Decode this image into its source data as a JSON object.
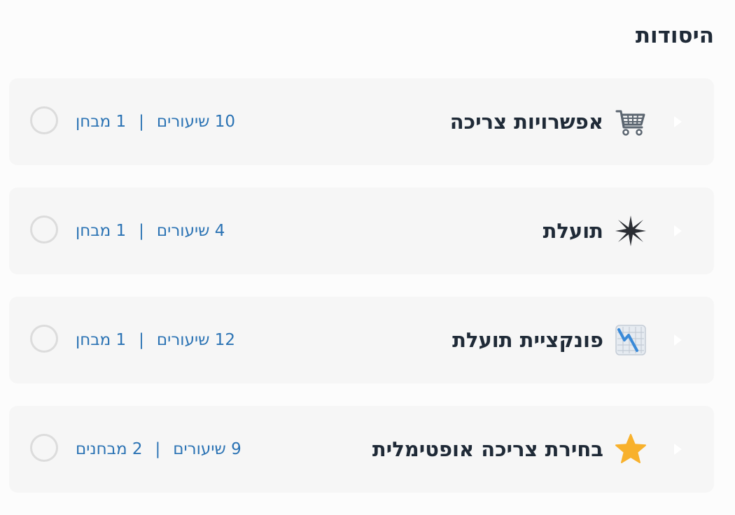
{
  "section": {
    "title": "היסודות"
  },
  "units": [
    {
      "title": "אפשרויות צריכה",
      "icon": "shopping-cart-icon",
      "lessons": "10 שיעורים",
      "separator": "|",
      "quizzes": "1 מבחן",
      "progress": 0
    },
    {
      "title": "תועלת",
      "icon": "sparkle-star-icon",
      "lessons": "4 שיעורים",
      "separator": "|",
      "quizzes": "1 מבחן",
      "progress": 0
    },
    {
      "title": "פונקציית תועלת",
      "icon": "chart-decreasing-icon",
      "lessons": "12 שיעורים",
      "separator": "|",
      "quizzes": "1 מבחן",
      "progress": 0
    },
    {
      "title": "בחירת צריכה אופטימלית",
      "icon": "star-icon",
      "lessons": "9 שיעורים",
      "separator": "|",
      "quizzes": "2 מבחנים",
      "progress": 0
    }
  ],
  "colors": {
    "meta_text": "#2b73b4",
    "title_text": "#1f2a37",
    "card_background": "#f6f6f6",
    "star_gold": "#f8b12c",
    "chart_blue": "#3a8ad8"
  }
}
